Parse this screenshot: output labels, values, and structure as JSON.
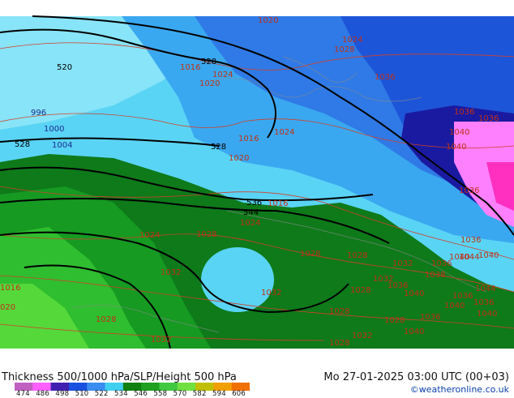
{
  "footer": {
    "title": "Thickness 500/1000 hPa/SLP/Height 500 hPa",
    "datetime": "Mo 27-01-2025 03:00 UTC (00+03)",
    "credit": "©weatheronline.co.uk",
    "scale_ticks": [
      "474",
      "486",
      "498",
      "510",
      "522",
      "534",
      "546",
      "558",
      "570",
      "582",
      "594",
      "606"
    ],
    "scale_colors": [
      "#c060c0",
      "#ff60ff",
      "#4020b0",
      "#1a50e0",
      "#3a8cf0",
      "#40d0f0",
      "#108010",
      "#20a020",
      "#40c840",
      "#70e040",
      "#c0c000",
      "#f0a000",
      "#f07000"
    ]
  },
  "slp_labels": [
    "1020",
    "1024",
    "1028",
    "1016",
    "1020",
    "1024",
    "1036",
    "1036",
    "1036",
    "1040",
    "1040",
    "1024",
    "1036",
    "1016",
    "1020",
    "996",
    "1000",
    "1004",
    "1016",
    "1024",
    "1020",
    "1024",
    "1028",
    "1036",
    "1032",
    "1028",
    "1028",
    "1032",
    "1036",
    "1040",
    "1044",
    "1038",
    "1032",
    "1036",
    "1032",
    "1040",
    "1028",
    "1036",
    "1040",
    "1040",
    "1040",
    "1028",
    "1036",
    "1040",
    "1036",
    "1044",
    "1016",
    "020",
    "1028",
    "1032",
    "1028",
    "1032",
    "1028",
    "1024"
  ],
  "height_labels": [
    "520",
    "528",
    "528",
    "528",
    "536",
    "544"
  ]
}
